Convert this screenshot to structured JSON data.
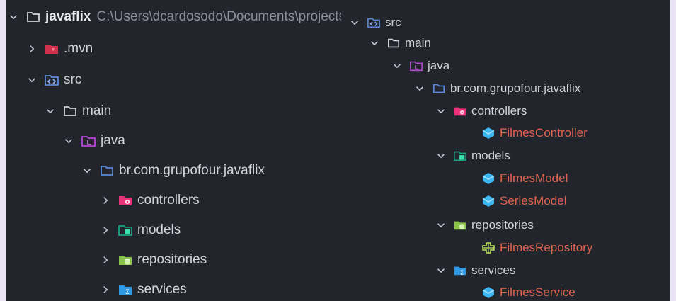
{
  "left_tree": {
    "root": {
      "label": "javaflix",
      "path": "C:\\Users\\dcardosodo\\Documents\\projects-"
    },
    "mvn": "​.mvn",
    "src": "src",
    "main": "main",
    "java": "java",
    "package": "br.com.grupofour.javaflix",
    "controllers": "controllers",
    "models": "models",
    "repositories": "repositories",
    "services": "services"
  },
  "right_tree": {
    "src": "src",
    "main": "main",
    "java": "java",
    "package": "br.com.grupofour.javaflix",
    "controllers": "controllers",
    "filmes_controller": "FilmesController",
    "models": "models",
    "filmes_model": "FilmesModel",
    "series_model": "SeriesModel",
    "repositories": "repositories",
    "filmes_repository": "FilmesRepository",
    "services": "services",
    "filmes_service": "FilmesService"
  },
  "colors": {
    "panel_bg": "#22252c",
    "text": "#d0d3da",
    "file_text": "#e0634f",
    "class_icon": "#3fb6f2",
    "controllers_folder": "#e8337a",
    "models_folder": "#1aa37f",
    "repositories_folder": "#8bc34a",
    "services_folder": "#2e9ae6",
    "java_folder": "#b04bd1",
    "src_folder": "#5b8bd8",
    "mvn_folder": "#d0304b"
  }
}
